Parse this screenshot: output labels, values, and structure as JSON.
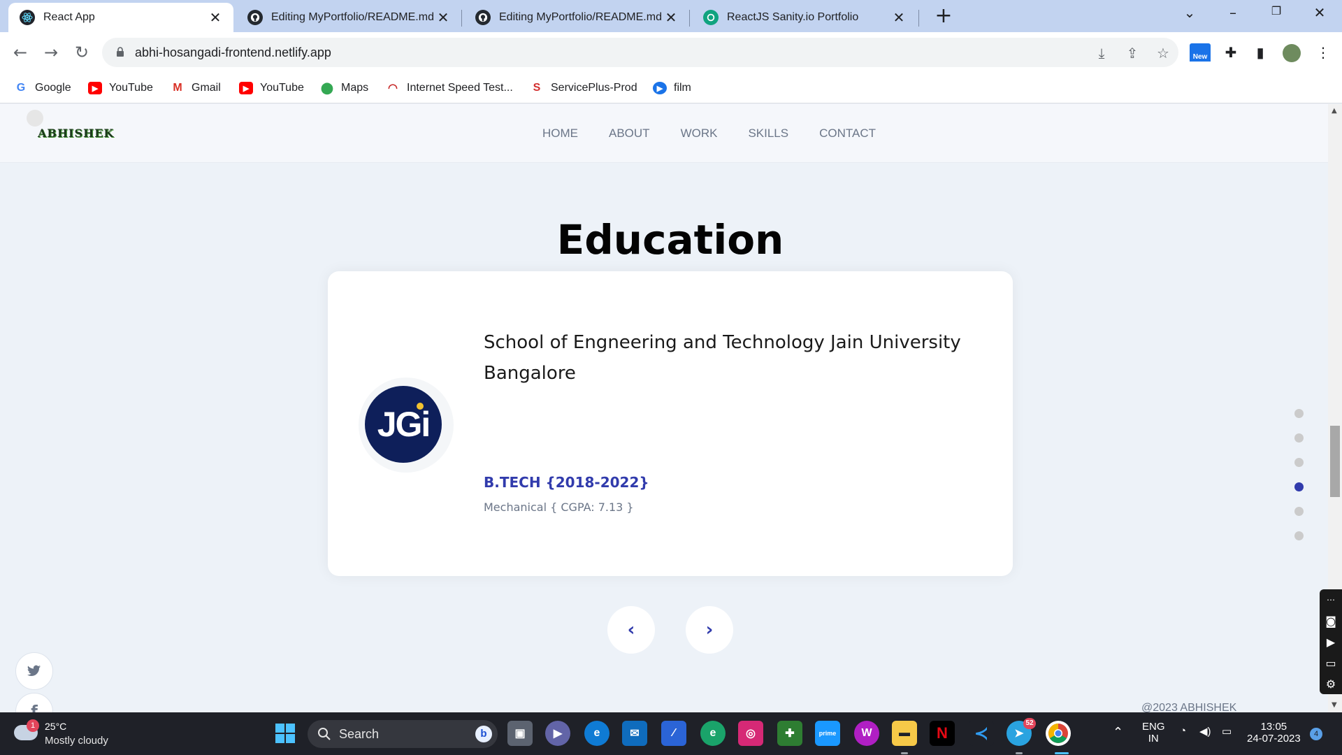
{
  "browser": {
    "tabs": [
      {
        "title": "React App",
        "active": true,
        "icon": "react-icon"
      },
      {
        "title": "Editing MyPortfolio/README.md",
        "active": false,
        "icon": "github-icon"
      },
      {
        "title": "Editing MyPortfolio/README.md",
        "active": false,
        "icon": "github-icon"
      },
      {
        "title": "ReactJS Sanity.io Portfolio",
        "active": false,
        "icon": "openai-icon"
      }
    ],
    "url": "abhi-hosangadi-frontend.netlify.app",
    "new_badge": "New",
    "bookmarks": [
      {
        "label": "Google",
        "icon": "google-icon",
        "color": "#4285f4"
      },
      {
        "label": "YouTube",
        "icon": "youtube-icon",
        "color": "#ff0000"
      },
      {
        "label": "Gmail",
        "icon": "gmail-icon",
        "color": "#d93025"
      },
      {
        "label": "YouTube",
        "icon": "youtube-icon",
        "color": "#ff0000"
      },
      {
        "label": "Maps",
        "icon": "maps-icon",
        "color": "#34a853"
      },
      {
        "label": "Internet Speed Test...",
        "icon": "speedtest-icon",
        "color": "#c62828"
      },
      {
        "label": "ServicePlus-Prod",
        "icon": "serviceplus-icon",
        "color": "#d32f2f"
      },
      {
        "label": "film",
        "icon": "play-icon",
        "color": "#1a73e8"
      }
    ]
  },
  "site": {
    "logo": "ABHISHEK",
    "nav": [
      "HOME",
      "ABOUT",
      "WORK",
      "SKILLS",
      "CONTACT"
    ],
    "section_title": "Education",
    "education": {
      "institution_logo": "JGi",
      "institution": "School of Engneering and Technology Jain University Bangalore",
      "degree": "B.TECH {2018-2022}",
      "detail": "Mechanical { CGPA: 7.13 }"
    },
    "prev_symbol": "‹",
    "next_symbol": "›",
    "section_dots": {
      "count": 6,
      "active_index": 3
    },
    "copyright": "@2023 ABHISHEK",
    "accent_color": "#313bac"
  },
  "taskbar": {
    "weather": {
      "temp": "25°C",
      "desc": "Mostly cloudy",
      "badge": "1"
    },
    "search_label": "Search",
    "telegram_badge": "52",
    "language": {
      "line1": "ENG",
      "line2": "IN"
    },
    "time": "13:05",
    "date": "24-07-2023",
    "notification_count": "4"
  }
}
